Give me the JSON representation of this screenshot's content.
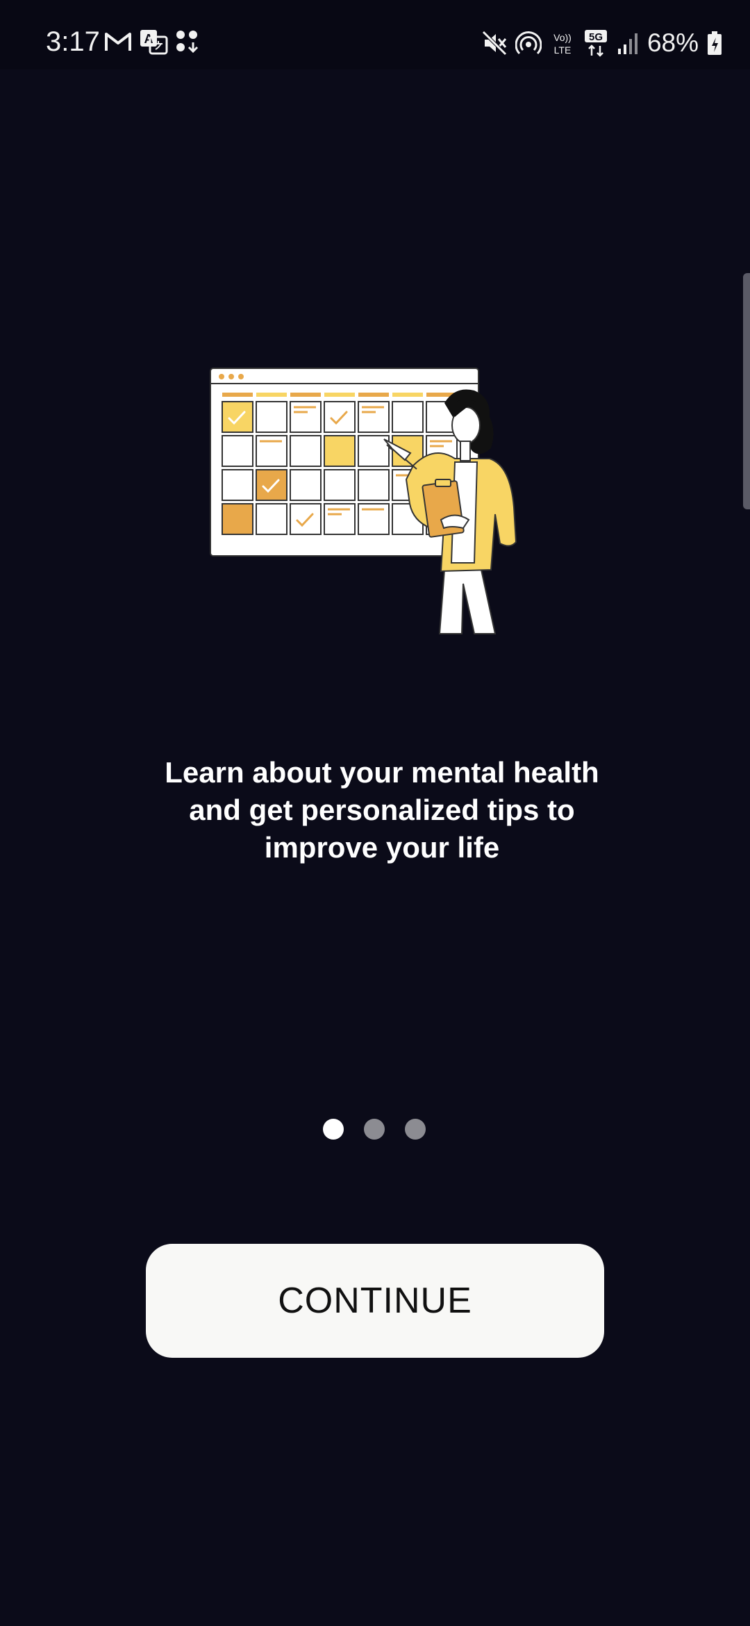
{
  "status_bar": {
    "time": "3:17",
    "battery_percent": "68%",
    "left_icons": [
      "gmail-icon",
      "translate-icon",
      "app-download-icon"
    ],
    "right_icons": [
      "mute-icon",
      "hotspot-icon",
      "volte-icon",
      "5g-icon",
      "signal-icon",
      "battery-icon"
    ],
    "volte_label": "Vo)) LTE",
    "network_label": "5G"
  },
  "onboarding": {
    "illustration": "calendar-planning-illustration",
    "headline": "Learn about your mental health\nand get personalized tips to\nimprove your life",
    "page_index": 1,
    "page_count": 3
  },
  "continue_button": {
    "label": "CONTINUE"
  },
  "colors": {
    "background": "#0b0b19",
    "button_background": "#f8f8f6",
    "button_text": "#111111",
    "dot_active": "#ffffff",
    "dot_inactive": "#8c8c92",
    "accent_yellow": "#f8d564",
    "accent_orange": "#e8a84a"
  }
}
